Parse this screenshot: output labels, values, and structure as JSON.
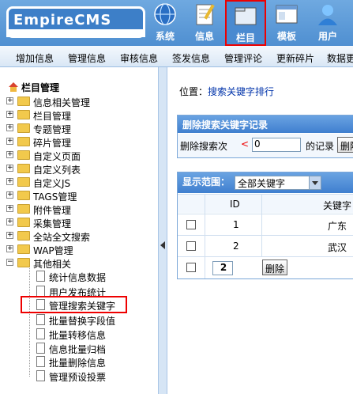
{
  "logo": {
    "text": "EmpireCMS"
  },
  "nav": [
    {
      "label": "系统",
      "icon": "globe-icon"
    },
    {
      "label": "信息",
      "icon": "notepad-icon"
    },
    {
      "label": "栏目",
      "icon": "folder-icon",
      "active": true
    },
    {
      "label": "模板",
      "icon": "window-icon"
    },
    {
      "label": "用户",
      "icon": "user-icon"
    }
  ],
  "menubar": [
    "增加信息",
    "管理信息",
    "审核信息",
    "签发信息",
    "管理评论",
    "更新碎片",
    "数据更"
  ],
  "sidebar": {
    "title": "栏目管理",
    "tree": [
      "信息相关管理",
      "栏目管理",
      "专题管理",
      "碎片管理",
      "自定义页面",
      "自定义列表",
      "自定义JS",
      "TAGS管理",
      "附件管理",
      "采集管理",
      "全站全文搜索",
      "WAP管理",
      "其他相关"
    ],
    "leaves": [
      "统计信息数据",
      "用户发布统计",
      "管理搜索关键字",
      "批量替换字段值",
      "批量转移信息",
      "信息批量归档",
      "批量删除信息",
      "管理预设投票"
    ]
  },
  "breadcrumb": {
    "prefix": "位置：",
    "link": "搜索关键字排行"
  },
  "delete_panel": {
    "title": "删除搜索关键字记录",
    "label": "删除搜索次",
    "lt": "<",
    "value": "0",
    "suffix": "的记录",
    "button": "删除"
  },
  "list_panel": {
    "scope_label": "显示范围：",
    "scope_value": "全部关键字",
    "col_id": "ID",
    "col_keyword": "关键字",
    "rows": [
      {
        "id": "1",
        "keyword": "广东"
      },
      {
        "id": "2",
        "keyword": "武汉"
      }
    ],
    "page": "2",
    "delete_button": "删除"
  },
  "colors": {
    "header": "#4f8fd1",
    "active_border": "#e00000",
    "link": "#0033aa"
  }
}
